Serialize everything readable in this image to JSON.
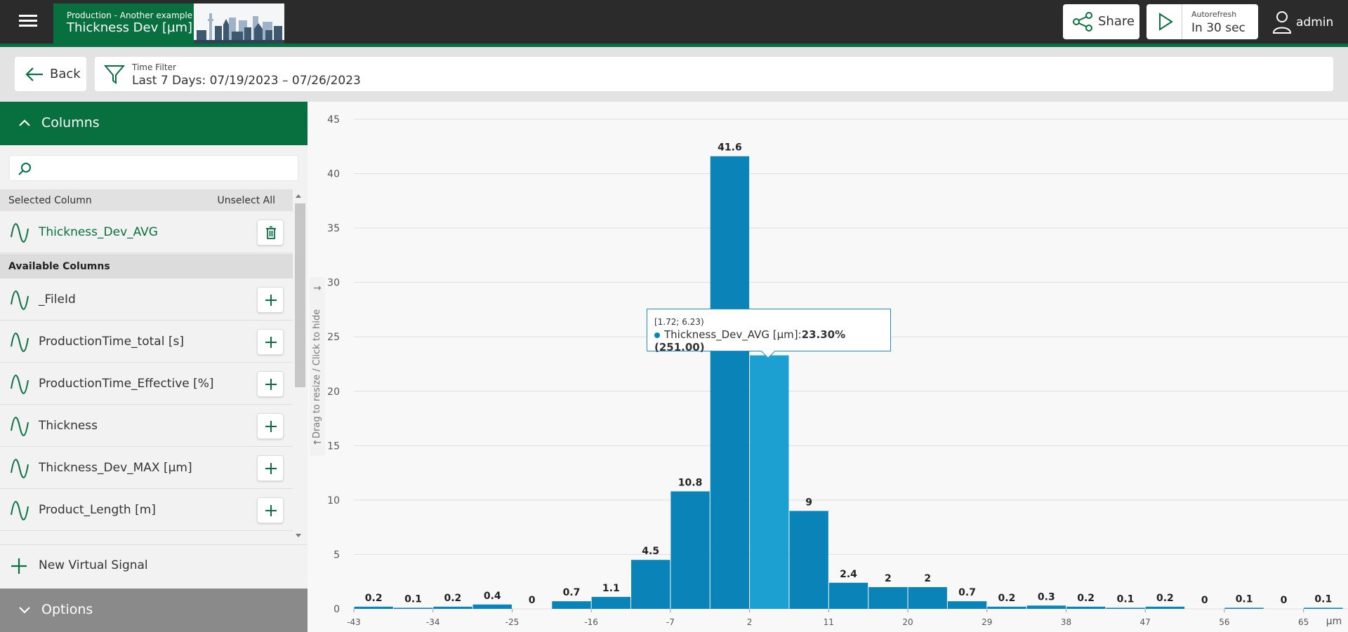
{
  "header": {
    "subtitle": "Production - Another example",
    "title": "Thickness Dev [µm]",
    "share_label": "Share",
    "autorefresh_label": "Autorefresh",
    "autorefresh_value": "In 30 sec",
    "user": "admin"
  },
  "toolbar": {
    "back_label": "Back",
    "time_filter_label": "Time Filter",
    "time_filter_value": "Last 7 Days: 07/19/2023 – 07/26/2023"
  },
  "sidebar": {
    "columns_label": "Columns",
    "search_placeholder": "",
    "selected_header": "Selected Column",
    "unselect_all": "Unselect All",
    "selected": [
      {
        "name": "Thickness_Dev_AVG"
      }
    ],
    "available_header": "Available Columns",
    "available": [
      {
        "name": "_FileId"
      },
      {
        "name": "ProductionTime_total [s]"
      },
      {
        "name": "ProductionTime_Effective [%]"
      },
      {
        "name": "Thickness"
      },
      {
        "name": "Thickness_Dev_MAX [µm]"
      },
      {
        "name": "Product_Length [m]"
      }
    ],
    "new_virtual_signal": "New Virtual Signal",
    "options_label": "Options",
    "resize_hint": "Drag to resize / Click to hide"
  },
  "tooltip": {
    "range": "[1.72; 6.23)",
    "series": "Thickness_Dev_AVG [µm]:",
    "value": "23.30% (251.00)"
  },
  "colors": {
    "brand": "#08703e",
    "bar": "#0a84b8",
    "bar_highlight": "#1c9fd1"
  },
  "chart_data": {
    "type": "bar",
    "xunit": "µm",
    "ylim": [
      0,
      45
    ],
    "yticks": [
      0,
      5,
      10,
      15,
      20,
      25,
      30,
      35,
      40,
      45
    ],
    "xticks": [
      "-43",
      "-34",
      "-25",
      "-16",
      "-7",
      "2",
      "11",
      "20",
      "29",
      "38",
      "47",
      "56",
      "65"
    ],
    "values": [
      0.2,
      0.1,
      0.2,
      0.4,
      0,
      0.7,
      1.1,
      4.5,
      10.8,
      41.6,
      23.3,
      9,
      2.4,
      2,
      2,
      0.7,
      0.2,
      0.3,
      0.2,
      0.1,
      0.2,
      0,
      0.1,
      0,
      0.1
    ],
    "labels": [
      "0.2",
      "0.1",
      "0.2",
      "0.4",
      "0",
      "0.7",
      "1.1",
      "4.5",
      "10.8",
      "41.6",
      "",
      "9",
      "2.4",
      "2",
      "2",
      "0.7",
      "0.2",
      "0.3",
      "0.2",
      "0.1",
      "0.2",
      "0",
      "0.1",
      "0",
      "0.1"
    ],
    "highlight_index": 10,
    "grid": true
  }
}
